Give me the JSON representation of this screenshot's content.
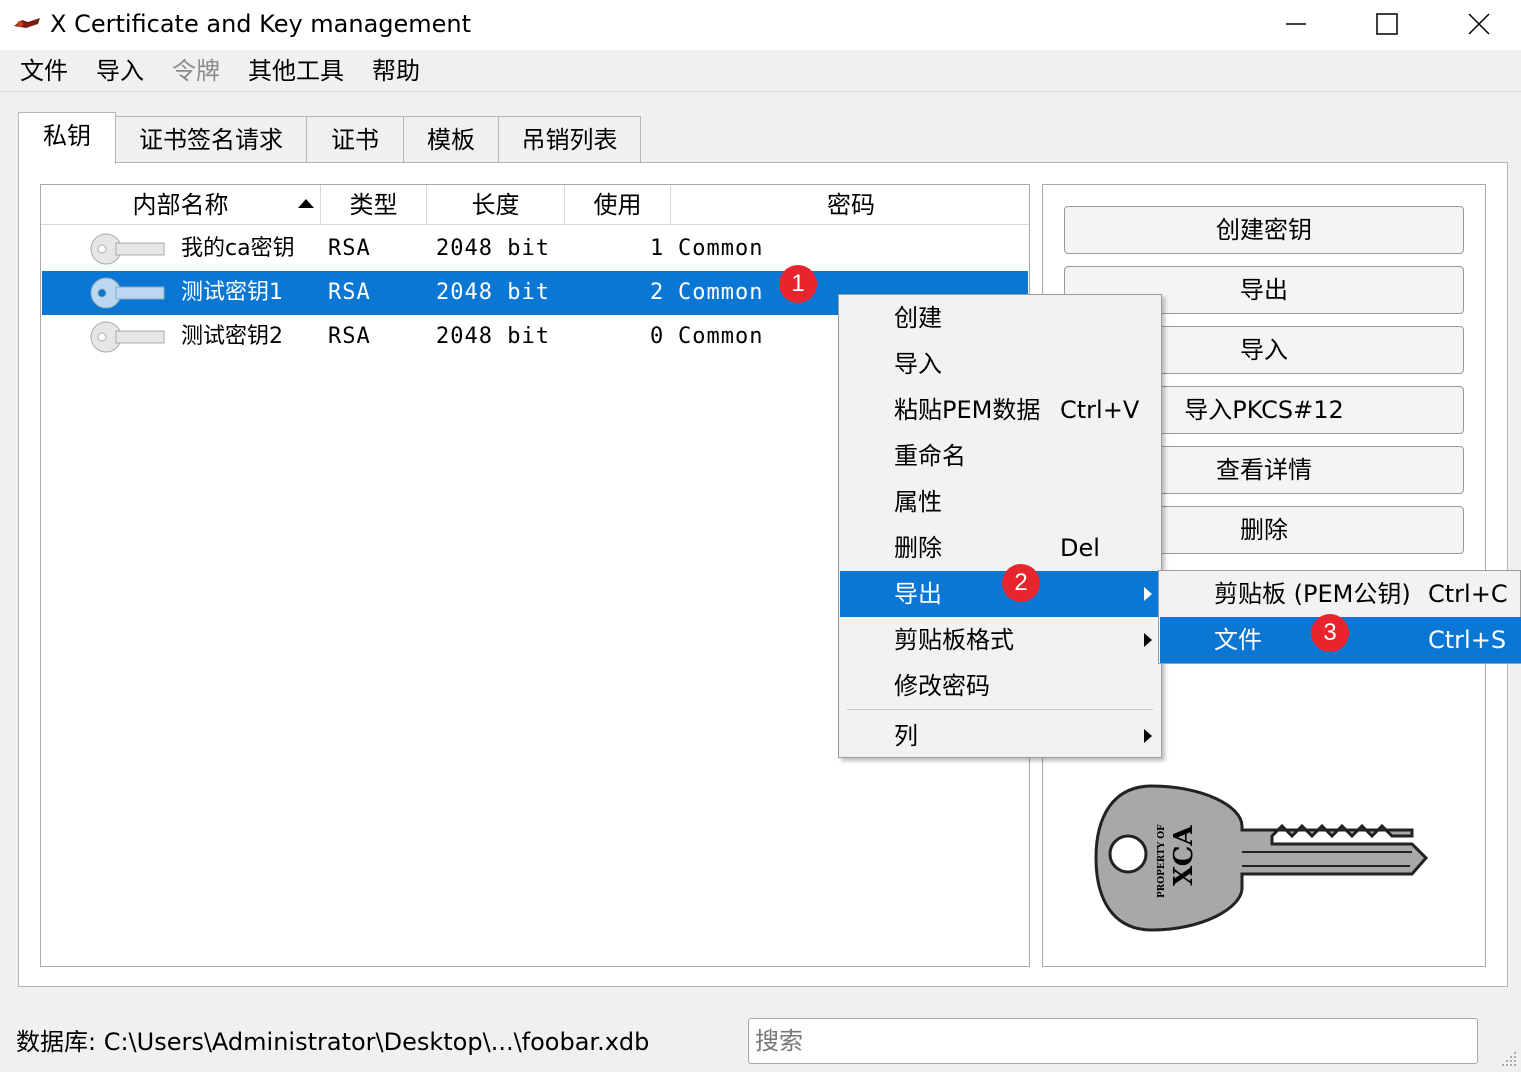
{
  "window": {
    "title": "X Certificate and Key management"
  },
  "menubar": {
    "items": [
      "文件",
      "导入",
      "令牌",
      "其他工具",
      "帮助"
    ]
  },
  "tabs": [
    "私钥",
    "证书签名请求",
    "证书",
    "模板",
    "吊销列表"
  ],
  "table": {
    "columns": [
      "内部名称",
      "类型",
      "长度",
      "使用",
      "密码"
    ],
    "rows": [
      {
        "name": "我的ca密钥",
        "type": "RSA",
        "length": "2048 bit",
        "use": "1",
        "password": "Common",
        "selected": false
      },
      {
        "name": "测试密钥1",
        "type": "RSA",
        "length": "2048 bit",
        "use": "2",
        "password": "Common",
        "selected": true
      },
      {
        "name": "测试密钥2",
        "type": "RSA",
        "length": "2048 bit",
        "use": "0",
        "password": "Common",
        "selected": false
      }
    ]
  },
  "side_buttons": [
    "创建密钥",
    "导出",
    "导入",
    "导入PKCS#12",
    "查看详情",
    "删除"
  ],
  "key_image": {
    "line1": "PROPERTY OF",
    "line2": "XCA"
  },
  "context_menu": {
    "items": [
      {
        "label": "创建",
        "shortcut": ""
      },
      {
        "label": "导入",
        "shortcut": ""
      },
      {
        "label": "粘贴PEM数据",
        "shortcut": "Ctrl+V"
      },
      {
        "label": "重命名",
        "shortcut": ""
      },
      {
        "label": "属性",
        "shortcut": ""
      },
      {
        "label": "删除",
        "shortcut": "Del"
      },
      {
        "label": "导出",
        "shortcut": "",
        "submenu": true,
        "highlighted": true
      },
      {
        "label": "剪贴板格式",
        "shortcut": "",
        "submenu": true
      },
      {
        "label": "修改密码",
        "shortcut": ""
      },
      {
        "label": "列",
        "shortcut": "",
        "submenu": true
      }
    ]
  },
  "export_submenu": {
    "items": [
      {
        "label": "剪贴板 (PEM公钥)",
        "shortcut": "Ctrl+C"
      },
      {
        "label": "文件",
        "shortcut": "Ctrl+S",
        "highlighted": true
      }
    ]
  },
  "badges": [
    "1",
    "2",
    "3"
  ],
  "statusbar": {
    "database": "数据库: C:\\Users\\Administrator\\Desktop\\...\\foobar.xdb"
  },
  "search": {
    "placeholder": "搜索"
  },
  "colors": {
    "selection": "#0a77d5",
    "badge": "#e8242c"
  }
}
